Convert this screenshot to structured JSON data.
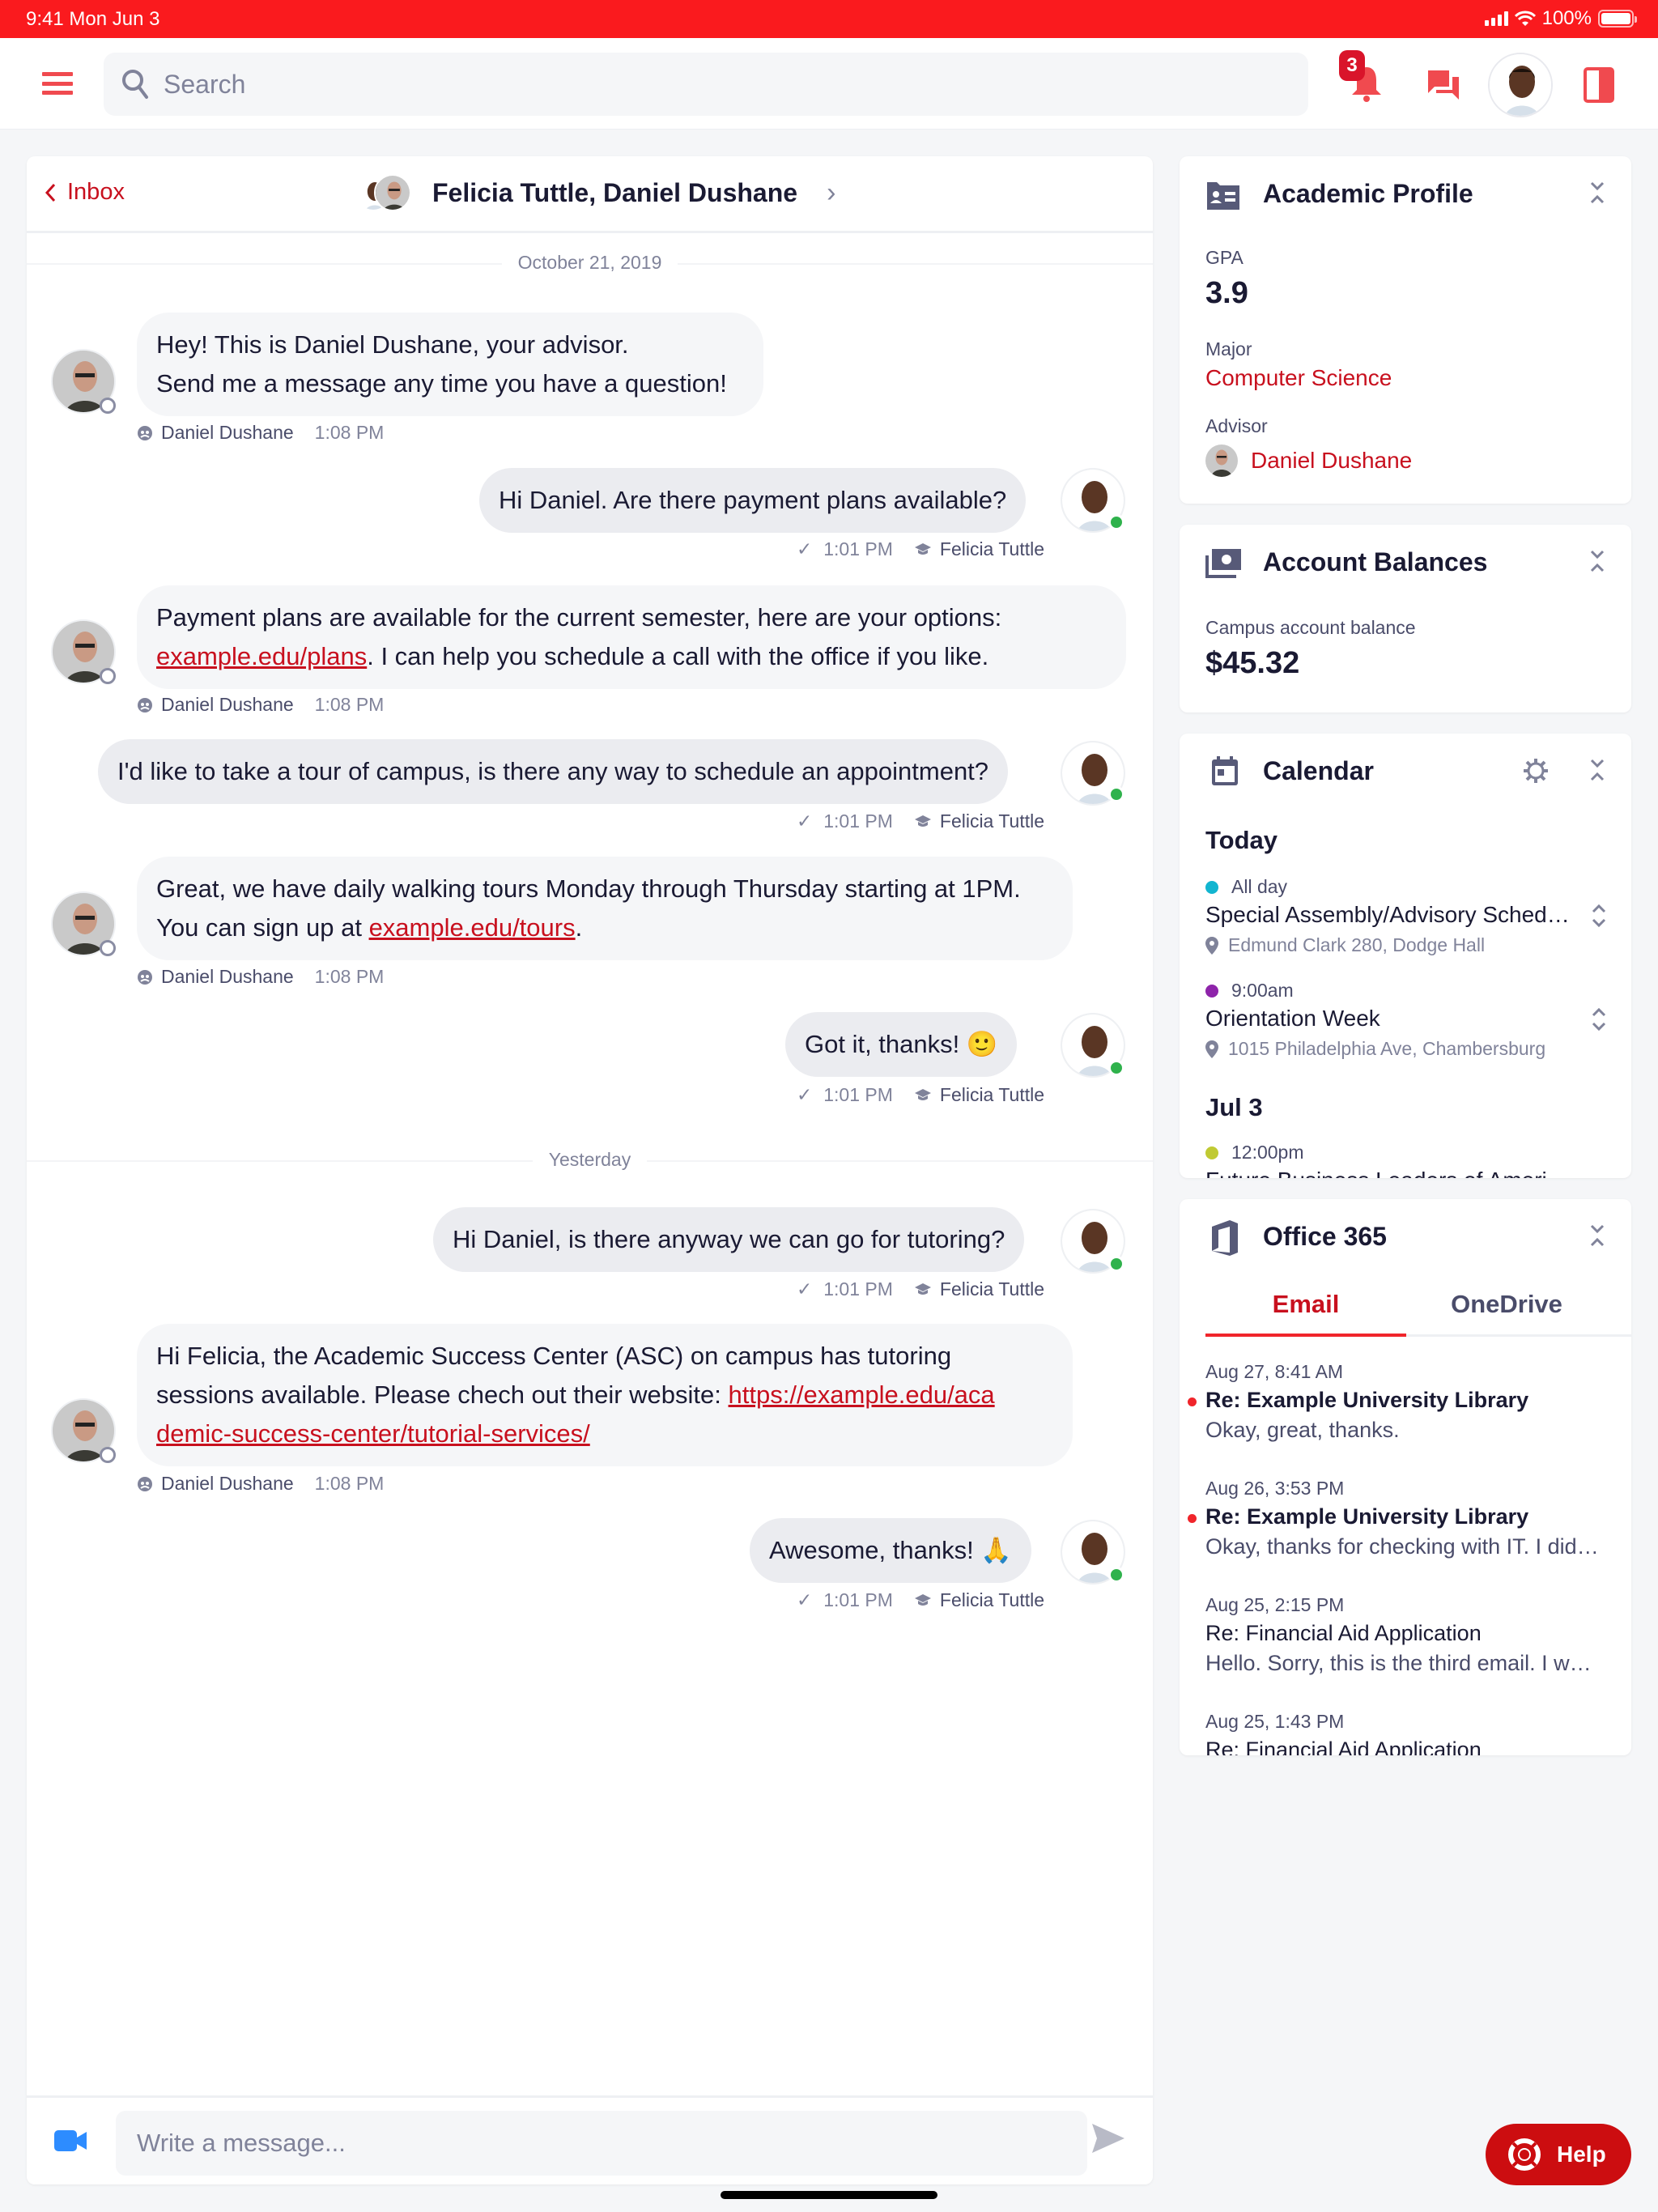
{
  "status_bar": {
    "time": "9:41  Mon Jun 3",
    "battery": "100%"
  },
  "top_nav": {
    "search_placeholder": "Search",
    "notification_count": "3"
  },
  "chat": {
    "back_label": "Inbox",
    "title": "Felicia Tuttle, Daniel Dushane",
    "date_separators": [
      "October 21, 2019",
      "Yesterday"
    ],
    "messages": [
      {
        "sender": "Daniel Dushane",
        "side": "left",
        "time": "1:08 PM",
        "lines": [
          "Hey! This is Daniel Dushane, your advisor.",
          "Send me a message any time you have a question!"
        ]
      },
      {
        "sender": "Felicia Tuttle",
        "side": "right",
        "time": "1:01 PM",
        "text": "Hi Daniel. Are there payment plans available?"
      },
      {
        "sender": "Daniel Dushane",
        "side": "left",
        "time": "1:08 PM",
        "text_before": "Payment plans are available for the current semester, here are your options:",
        "link": "example.edu/plans",
        "text_after": ". I can help you schedule a call with the office if you like."
      },
      {
        "sender": "Felicia Tuttle",
        "side": "right",
        "time": "1:01 PM",
        "text": "I'd like to take a tour of campus, is there any way to schedule an appointment?"
      },
      {
        "sender": "Daniel Dushane",
        "side": "left",
        "time": "1:08 PM",
        "text_before": "Great, we have daily walking tours Monday through Thursday starting at 1PM.",
        "text_mid": "You can sign up at ",
        "link": "example.edu/tours",
        "text_after": "."
      },
      {
        "sender": "Felicia Tuttle",
        "side": "right",
        "time": "1:01 PM",
        "text": "Got it, thanks! 🙂"
      },
      {
        "sender": "Felicia Tuttle",
        "side": "right",
        "time": "1:01 PM",
        "text": "Hi Daniel, is there anyway we can go for tutoring?"
      },
      {
        "sender": "Daniel Dushane",
        "side": "left",
        "time": "1:08 PM",
        "text_before": "Hi Felicia, the Academic Success Center (ASC) on campus has tutoring sessions available. Please chech out their website: ",
        "link": "https://example.edu/academic-success-center/tutorial-services/"
      },
      {
        "sender": "Felicia Tuttle",
        "side": "right",
        "time": "1:01 PM",
        "text": "Awesome, thanks! 🙏"
      }
    ],
    "composer_placeholder": "Write a message..."
  },
  "academic_profile": {
    "title": "Academic Profile",
    "gpa_label": "GPA",
    "gpa": "3.9",
    "major_label": "Major",
    "major": "Computer Science",
    "advisor_label": "Advisor",
    "advisor": "Daniel Dushane"
  },
  "account_balances": {
    "title": "Account Balances",
    "label": "Campus account balance",
    "amount": "$45.32"
  },
  "calendar": {
    "title": "Calendar",
    "days": [
      {
        "label": "Today",
        "events": [
          {
            "time": "All day",
            "color": "#12b5d0",
            "title": "Special Assembly/Advisory Schedule",
            "location": "Edmund Clark 280, Dodge Hall"
          },
          {
            "time": "9:00am",
            "color": "#8e24aa",
            "title": "Orientation Week",
            "location": "1015 Philadelphia Ave, Chambersburg"
          }
        ]
      },
      {
        "label": "Jul 3",
        "events": [
          {
            "time": "12:00pm",
            "color": "#c0ca33",
            "title": "Future Business Leaders of America"
          }
        ]
      }
    ]
  },
  "office365": {
    "title": "Office 365",
    "tabs": [
      "Email",
      "OneDrive"
    ],
    "active_tab": "Email",
    "emails": [
      {
        "date": "Aug 27, 8:41 AM",
        "subject": "Re: Example University Library",
        "preview": "Okay, great, thanks.",
        "unread": true
      },
      {
        "date": "Aug 26, 3:53 PM",
        "subject": "Re: Example University Library",
        "preview": "Okay, thanks for checking with IT. I did try that but it still won't work",
        "unread": true
      },
      {
        "date": "Aug 25, 2:15 PM",
        "subject": "Re: Financial Aid Application",
        "preview": "Hello. Sorry, this is the third email. I wanted to follow up",
        "unread": false
      },
      {
        "date": "Aug 25, 1:43 PM",
        "subject": "Re: Financial Aid Application",
        "preview": "",
        "unread": false
      }
    ]
  },
  "help": {
    "label": "Help"
  },
  "colors": {
    "brand_red": "#fa1a1e",
    "link_red": "#c8101e",
    "online_green": "#2fb24c",
    "video_blue": "#2d8cff"
  }
}
